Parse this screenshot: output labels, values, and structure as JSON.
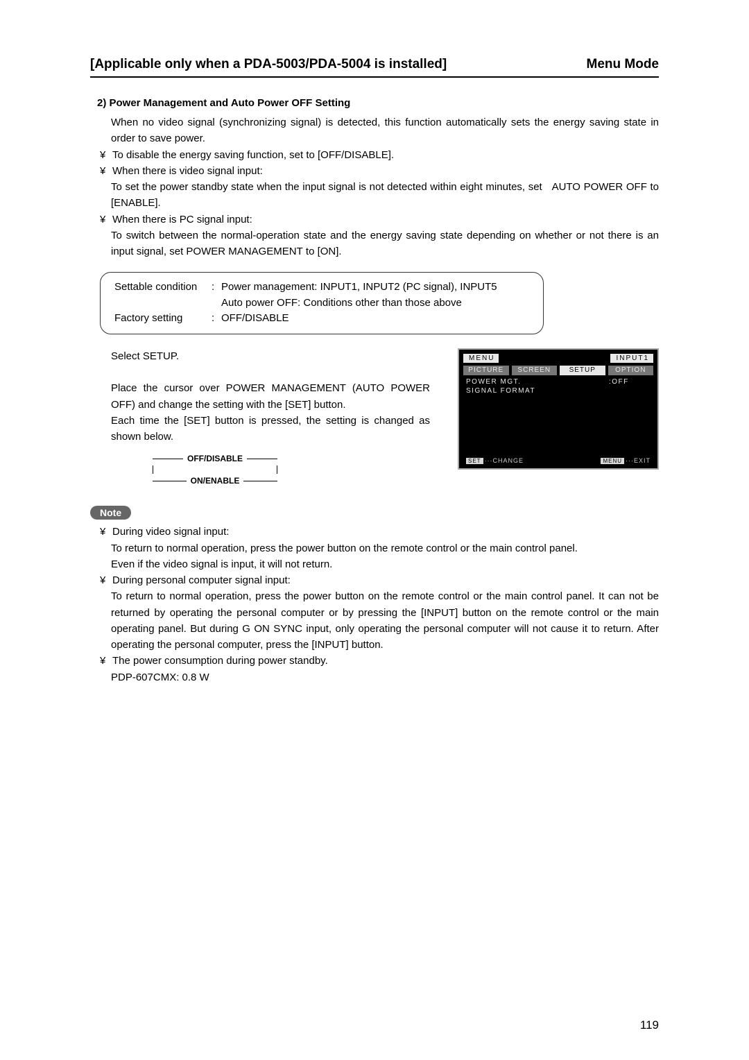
{
  "header": {
    "left": "[Applicable only when a PDA-5003/PDA-5004 is installed]",
    "right": "Menu Mode"
  },
  "section_title": "2) Power Management and Auto Power OFF Setting",
  "intro": "When no video signal (synchronizing signal) is detected, this function automatically sets the energy saving state in order to save power.",
  "bullets_a": [
    {
      "glyph": "¥",
      "text": "To disable the energy saving function, set to [OFF/DISABLE]."
    },
    {
      "glyph": "¥",
      "text": "When there is video signal input:"
    }
  ],
  "bullet_a2_sub": "To set the power standby state when the input signal is not detected within eight minutes, set   AUTO POWER OFF to [ENABLE].",
  "bullets_a3": {
    "glyph": "¥",
    "text": "When there is PC signal input:"
  },
  "bullet_a3_sub": "To switch between the normal-operation state and the energy saving state depending on whether or not there is an input signal, set POWER MANAGEMENT to [ON].",
  "settings_box": {
    "row1_label": "Settable condition",
    "row1_sep": ":",
    "row1_val1": "Power management: INPUT1, INPUT2 (PC signal), INPUT5",
    "row1_val2": "Auto power OFF: Conditions other than those above",
    "row2_label": "Factory setting",
    "row2_sep": ":",
    "row2_val": "OFF/DISABLE"
  },
  "instructions": {
    "p1": "Select SETUP.",
    "p2": "Place the cursor over POWER MANAGEMENT (AUTO POWER OFF) and change the setting with the [SET] button.",
    "p3": "Each time the [SET] button is pressed, the setting is changed as shown below."
  },
  "cycle": {
    "top": "OFF/DISABLE",
    "bottom": "ON/ENABLE"
  },
  "menu": {
    "title": "MENU",
    "input": "INPUT1",
    "tabs": [
      "PICTURE",
      "SCREEN",
      "SETUP",
      "OPTION"
    ],
    "active_tab_index": 2,
    "items": [
      {
        "label": "POWER MGT.",
        "value": ":OFF"
      },
      {
        "label": "SIGNAL FORMAT",
        "value": ""
      }
    ],
    "footer": {
      "left_key": "SET",
      "left_txt": "···CHANGE",
      "right_key": "MENU",
      "right_txt": "···EXIT"
    }
  },
  "note_label": "Note",
  "note_bullets": [
    {
      "glyph": "¥",
      "head": "During video signal input:",
      "lines": [
        "To return to normal operation, press the power button on the remote control or the main control panel.",
        "Even if the video signal is input, it will not return."
      ]
    },
    {
      "glyph": "¥",
      "head": "During personal computer signal input:",
      "lines": [
        "To return to normal operation, press the power button on the remote control or the main control panel. It can not be returned by operating the personal computer or by pressing the [INPUT] button on the remote control or the main operating panel. But during G ON SYNC input, only operating the personal computer will not cause it to return. After operating the personal computer, press the [INPUT] button."
      ]
    },
    {
      "glyph": "¥",
      "head": "The power consumption during power standby.",
      "lines": [
        "PDP-607CMX: 0.8 W"
      ]
    }
  ],
  "page_number": "119"
}
